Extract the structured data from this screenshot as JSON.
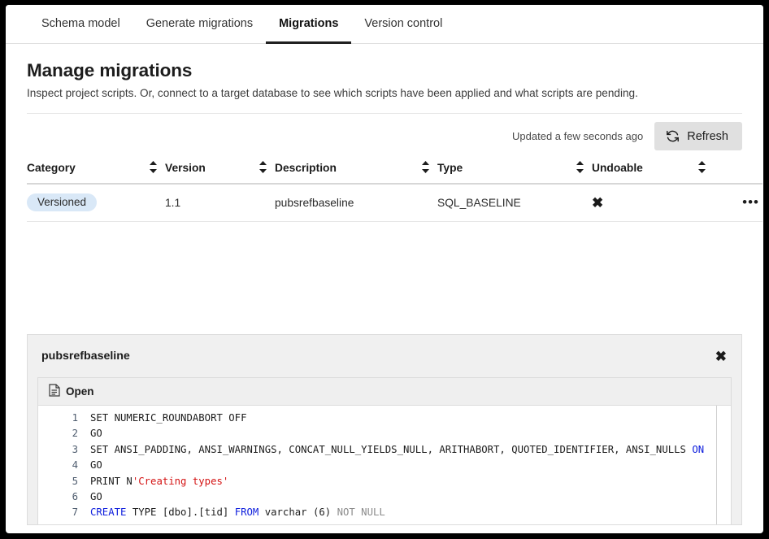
{
  "tabs": [
    {
      "label": "Schema model",
      "active": false
    },
    {
      "label": "Generate migrations",
      "active": false
    },
    {
      "label": "Migrations",
      "active": true
    },
    {
      "label": "Version control",
      "active": false
    }
  ],
  "page": {
    "title": "Manage migrations",
    "subtitle": "Inspect project scripts. Or, connect to a target database to see which scripts have been applied and what scripts are pending."
  },
  "toolbar": {
    "updated_text": "Updated a few seconds ago",
    "refresh_label": "Refresh",
    "refresh_icon": "refresh-icon"
  },
  "table": {
    "columns": [
      {
        "label": "Category",
        "sortable": true
      },
      {
        "label": "Version",
        "sortable": true
      },
      {
        "label": "Description",
        "sortable": true
      },
      {
        "label": "Type",
        "sortable": true
      },
      {
        "label": "Undoable",
        "sortable": true
      },
      {
        "label": "",
        "sortable": false
      }
    ],
    "rows": [
      {
        "category": "Versioned",
        "version": "1.1",
        "description": "pubsrefbaseline",
        "type": "SQL_BASELINE",
        "undoable": "✖",
        "menu": "•••"
      }
    ]
  },
  "detail": {
    "title": "pubsrefbaseline",
    "close_icon": "close-icon",
    "open_label": "Open",
    "open_icon": "document-icon",
    "line_numbers": [
      "1",
      "2",
      "3",
      "4",
      "5",
      "6",
      "7"
    ],
    "code_lines": [
      {
        "parts": [
          {
            "t": "SET NUMERIC_ROUNDABORT OFF",
            "c": "plain"
          }
        ]
      },
      {
        "parts": [
          {
            "t": "GO",
            "c": "plain"
          }
        ]
      },
      {
        "parts": [
          {
            "t": "SET ANSI_PADDING, ANSI_WARNINGS, CONCAT_NULL_YIELDS_NULL, ARITHABORT, QUOTED_IDENTIFIER, ANSI_NULLS ",
            "c": "plain"
          },
          {
            "t": "ON",
            "c": "kw"
          }
        ]
      },
      {
        "parts": [
          {
            "t": "GO",
            "c": "plain"
          }
        ]
      },
      {
        "parts": [
          {
            "t": "PRINT N",
            "c": "plain"
          },
          {
            "t": "'Creating types'",
            "c": "str"
          }
        ]
      },
      {
        "parts": [
          {
            "t": "GO",
            "c": "plain"
          }
        ]
      },
      {
        "parts": [
          {
            "t": "CREATE",
            "c": "kw"
          },
          {
            "t": " TYPE [dbo].[tid] ",
            "c": "plain"
          },
          {
            "t": "FROM",
            "c": "kw"
          },
          {
            "t": " varchar (6) ",
            "c": "plain"
          },
          {
            "t": "NOT NULL",
            "c": "gry"
          }
        ]
      }
    ]
  },
  "colors": {
    "accent_badge": "#d9e8f7",
    "keyword": "#1020dd",
    "string": "#d41414",
    "muted": "#8b8b8b",
    "button_bg": "#e0e0e0"
  }
}
